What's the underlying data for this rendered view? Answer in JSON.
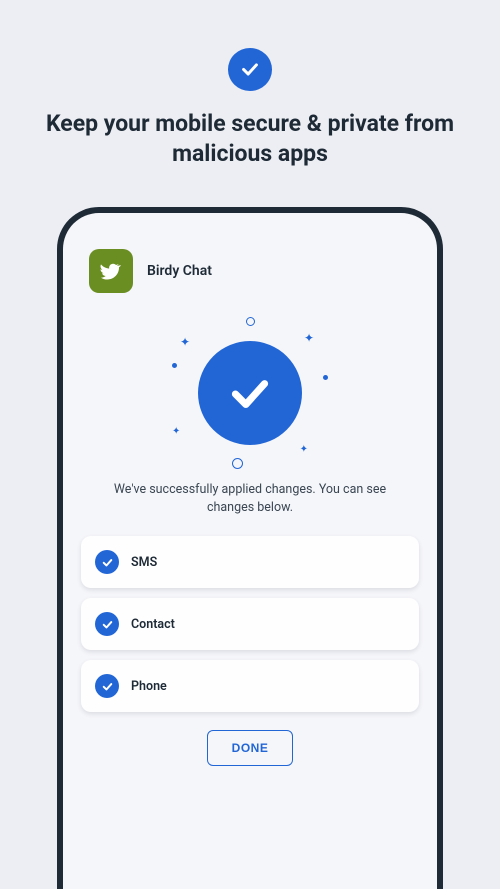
{
  "headline": "Keep your mobile secure & private from malicious apps",
  "phone": {
    "app_name": "Birdy Chat",
    "success_message": "We've successfully applied changes. You can see changes below.",
    "permissions": [
      {
        "label": "SMS"
      },
      {
        "label": "Contact"
      },
      {
        "label": "Phone"
      }
    ],
    "done_label": "DONE"
  }
}
